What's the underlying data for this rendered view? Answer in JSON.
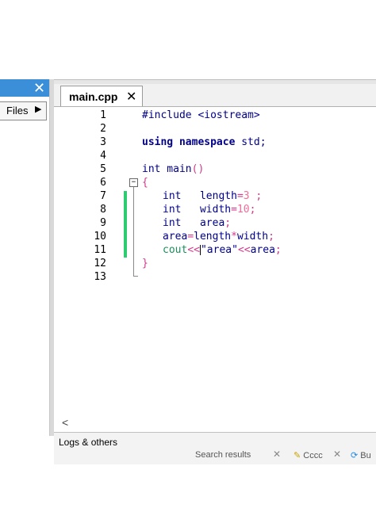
{
  "left_panel": {
    "close": "✕",
    "files_label": "Files",
    "files_arrow": "▶"
  },
  "editor_tab": {
    "label": "main.cpp",
    "close": "✕"
  },
  "code_lines": [
    {
      "n": "1"
    },
    {
      "n": "2"
    },
    {
      "n": "3"
    },
    {
      "n": "4"
    },
    {
      "n": "5"
    },
    {
      "n": "6"
    },
    {
      "n": "7"
    },
    {
      "n": "8"
    },
    {
      "n": "9"
    },
    {
      "n": "10"
    },
    {
      "n": "11"
    },
    {
      "n": "12"
    },
    {
      "n": "13"
    }
  ],
  "code": {
    "l1": "#include <iostream>",
    "l3_kw": "using namespace",
    "l3_rest": " std;",
    "l5_kw": "int",
    "l5_rest": " main",
    "l5_paren": "()",
    "l6": "{",
    "l7_kw": "int",
    "l7_name": "   length",
    "l7_eq": "=",
    "l7_num": "3",
    "l7_semi": " ;",
    "l8_kw": "int",
    "l8_name": "   width",
    "l8_eq": "=",
    "l8_num": "10",
    "l8_semi": ";",
    "l9_kw": "int",
    "l9_name": "   area",
    "l9_semi": ";",
    "l10_a": "area",
    "l10_eq": "=",
    "l10_b": "length",
    "l10_mul": "*",
    "l10_c": "width",
    "l10_semi": ";",
    "l11_kw": "cout",
    "l11_op1": "<<",
    "l11_str": "\"area\"",
    "l11_op2": "<<",
    "l11_var": "area",
    "l11_semi": ";",
    "l12": "}"
  },
  "fold_symbol": "−",
  "hscroll_left": "<",
  "bottom_panel": {
    "title": "Logs & others",
    "tab1": "Search results",
    "tab2": "Cccc",
    "tab3": "Bu"
  },
  "colors": {
    "change_bar": "#2ecc71",
    "keyword": "#00008b",
    "number": "#f36c9c",
    "title_bar": "#3a8fd8"
  }
}
